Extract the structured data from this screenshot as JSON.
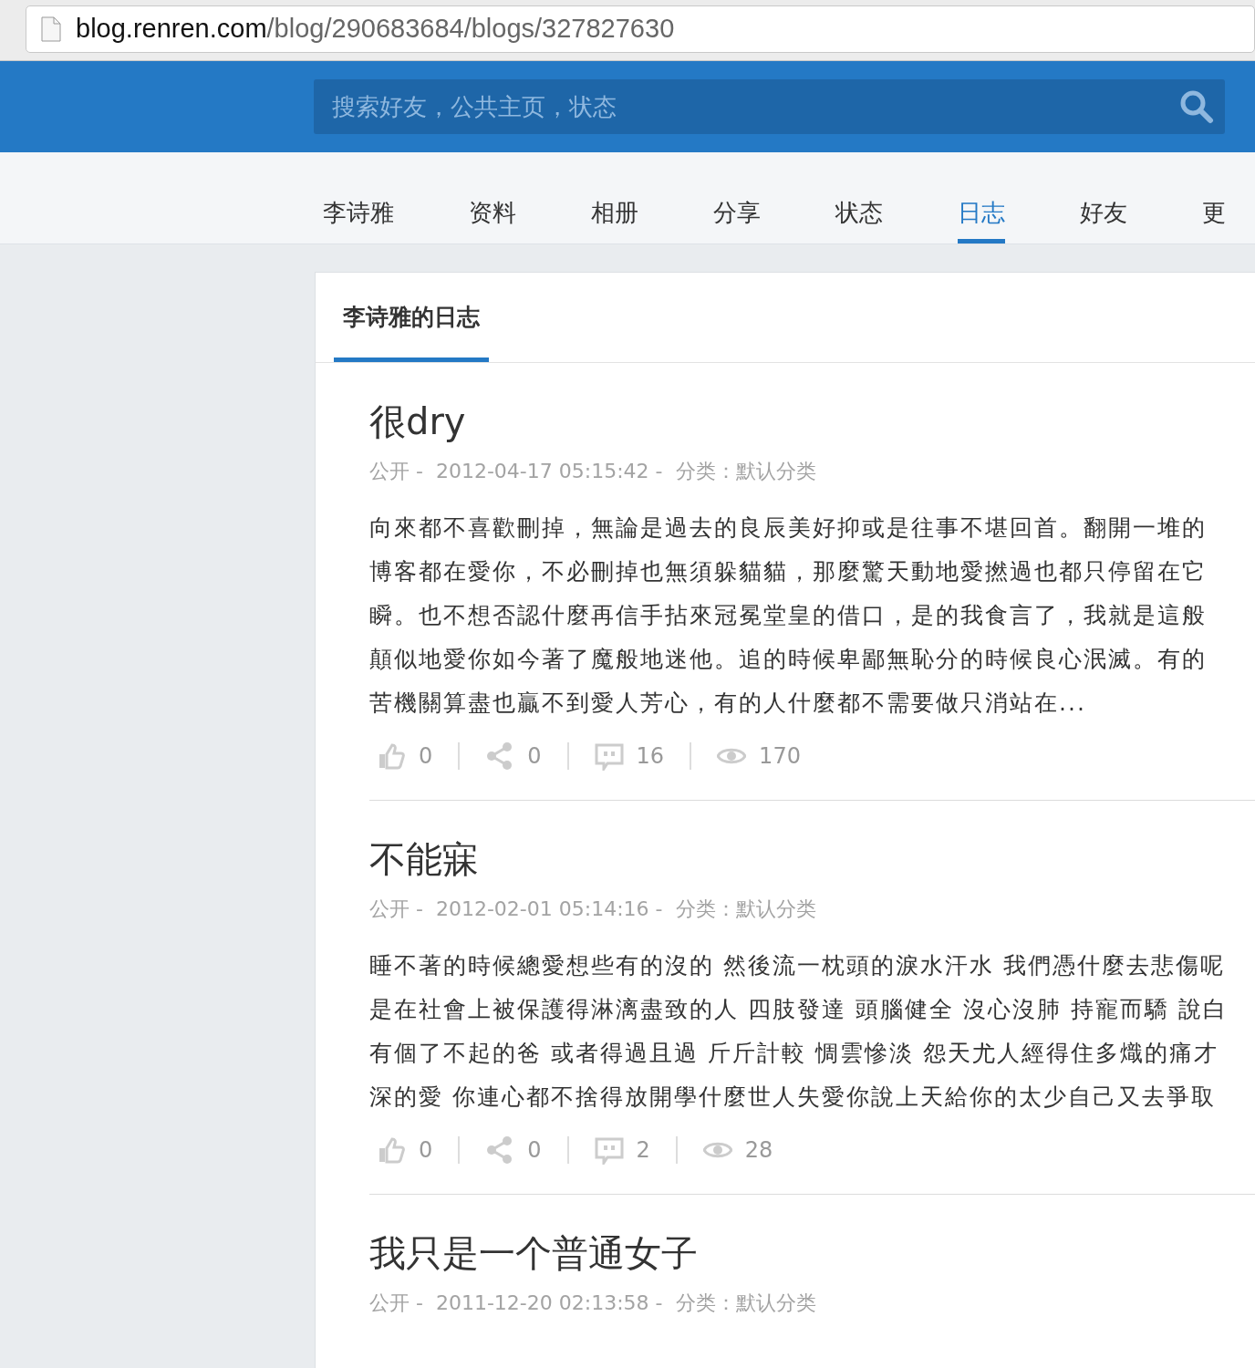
{
  "address_bar": {
    "domain": "blog.renren.com",
    "path": "/blog/290683684/blogs/327827630"
  },
  "search": {
    "placeholder": "搜索好友，公共主页，状态"
  },
  "tabs": [
    {
      "label": "李诗雅",
      "selected": false
    },
    {
      "label": "资料",
      "selected": false
    },
    {
      "label": "相册",
      "selected": false
    },
    {
      "label": "分享",
      "selected": false
    },
    {
      "label": "状态",
      "selected": false
    },
    {
      "label": "日志",
      "selected": true
    },
    {
      "label": "好友",
      "selected": false
    },
    {
      "label": "更",
      "selected": false
    }
  ],
  "panel": {
    "tab": "李诗雅的日志"
  },
  "posts": [
    {
      "title": "很dry",
      "visibility": "公开 -",
      "date": "2012-04-17 05:15:42 -",
      "category": "分类：默认分类",
      "lines": [
        "向來都不喜歡刪掉，無論是過去的良辰美好抑或是往事不堪回首。翻開一堆的",
        "博客都在愛你，不必刪掉也無須躲貓貓，那麼驚天動地愛撚過也都只停留在它",
        "瞬。也不想否認什麼再信手拈來冠冕堂皇的借口，是的我食言了，我就是這般",
        "顛似地愛你如今著了魔般地迷他。追的時候卑鄙無恥分的時候良心泯滅。有的",
        "苦機關算盡也贏不到愛人芳心，有的人什麼都不需要做只消站在..."
      ],
      "likes": "0",
      "shares": "0",
      "comments": "16",
      "views": "170"
    },
    {
      "title": "不能寐",
      "visibility": "公开 -",
      "date": "2012-02-01 05:14:16 -",
      "category": "分类：默认分类",
      "lines": [
        "睡不著的時候總愛想些有的沒的 然後流一枕頭的淚水汗水 我們憑什麼去悲傷呢",
        "是在社會上被保護得淋漓盡致的人 四肢發達 頭腦健全 沒心沒肺 持寵而驕 說白",
        "有個了不起的爸 或者得過且過 斤斤計較 惆雲慘淡 怨天尤人經得住多熾的痛才",
        "深的愛 你連心都不捨得放開學什麼世人失愛你說上天給你的太少自己又去爭取"
      ],
      "likes": "0",
      "shares": "0",
      "comments": "2",
      "views": "28"
    },
    {
      "title": "我只是一个普通女子",
      "visibility": "公开 -",
      "date": "2011-12-20 02:13:58 -",
      "category": "分类：默认分类"
    }
  ]
}
